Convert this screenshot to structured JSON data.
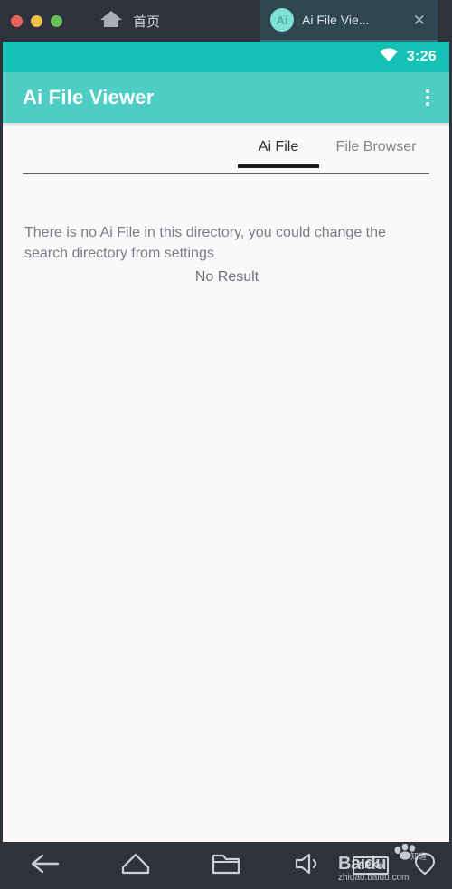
{
  "window": {
    "traffic_lights": [
      {
        "name": "close",
        "color": "#e8635a"
      },
      {
        "name": "minimize",
        "color": "#f2c14a"
      },
      {
        "name": "maximize",
        "color": "#68c15a"
      }
    ],
    "home_tab_label": "首页",
    "home_tab_icon": "home-icon",
    "app_tab": {
      "favicon_text": "Ai",
      "title": "Ai File Vie...",
      "close_icon": "close-icon"
    }
  },
  "statusbar": {
    "wifi_icon": "wifi-icon",
    "time": "3:26",
    "background": "#14c1b4"
  },
  "appbar": {
    "title": "Ai File Viewer",
    "overflow_icon": "more-vertical-icon",
    "background": "#4ecdc4",
    "text_color": "#ffffff"
  },
  "tabs": [
    {
      "label": "Ai File",
      "active": true
    },
    {
      "label": "File Browser",
      "active": false
    }
  ],
  "content": {
    "empty_message": "There is no Ai File in this directory, you could change the search directory from settings",
    "no_result": "No Result",
    "background": "#faf8fa",
    "text_color": "#7c7c82"
  },
  "navbar": {
    "background": "#2e323b",
    "buttons": [
      {
        "name": "back-icon",
        "label": ""
      },
      {
        "name": "home-icon",
        "label": ""
      },
      {
        "name": "folder-icon",
        "label": ""
      },
      {
        "name": "volume-icon",
        "label": ""
      },
      {
        "name": "apk-install-icon",
        "label": "APK+"
      },
      {
        "name": "location-pin-icon",
        "label": ""
      }
    ]
  },
  "watermark": {
    "brand": "Baidu",
    "domain": "zhidao.baidu.com",
    "cn_text": "知道"
  }
}
